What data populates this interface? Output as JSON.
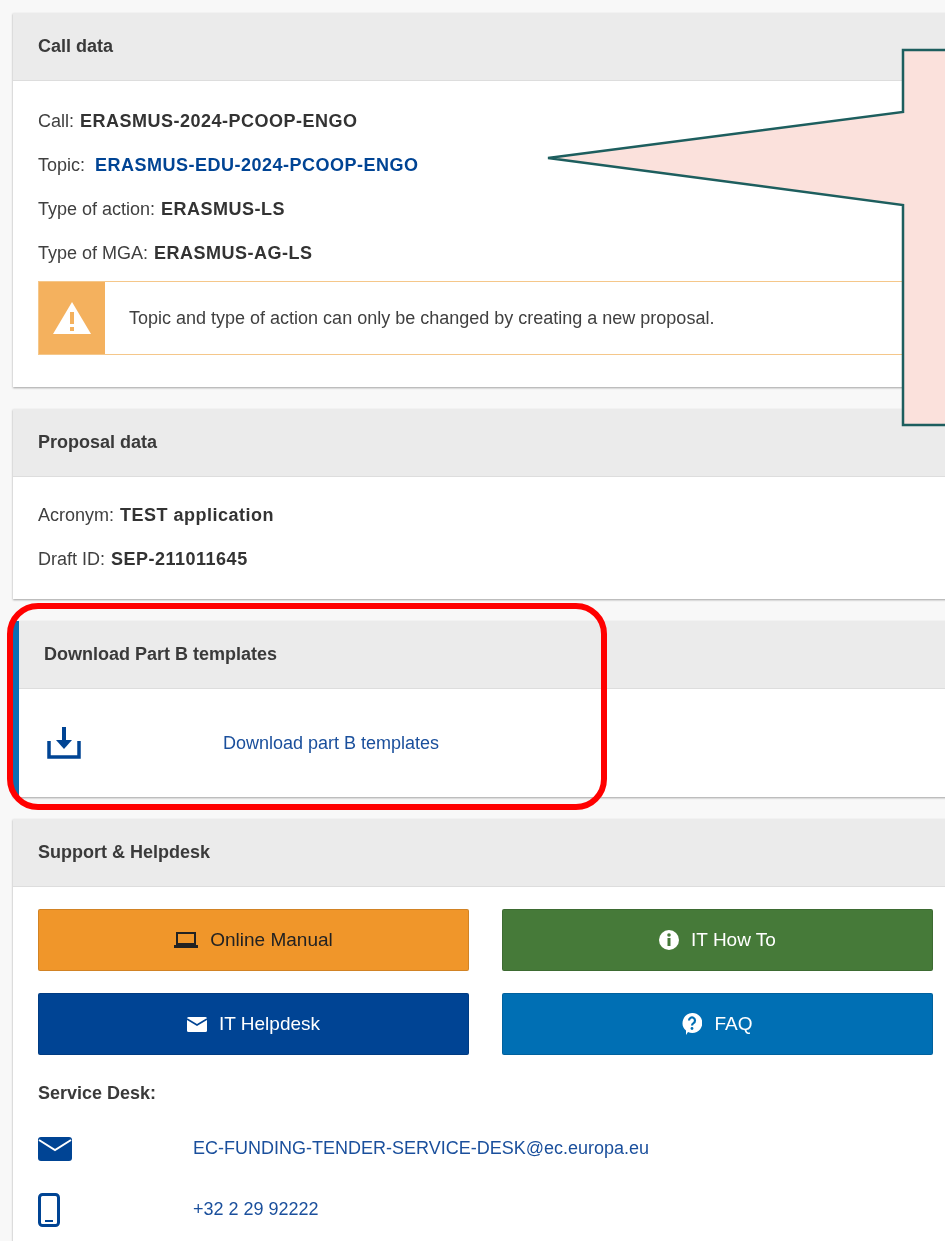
{
  "call_data": {
    "title": "Call data",
    "rows": [
      {
        "label": "Call:",
        "value": "ERASMUS-2024-PCOOP-ENGO",
        "kind": "text"
      },
      {
        "label": "Topic:",
        "value": "ERASMUS-EDU-2024-PCOOP-ENGO",
        "kind": "link"
      },
      {
        "label": "Type of action:",
        "value": "ERASMUS-LS",
        "kind": "text"
      },
      {
        "label": "Type of MGA:",
        "value": "ERASMUS-AG-LS",
        "kind": "text"
      }
    ],
    "warning": "Topic and type of action can only be changed by creating a new proposal."
  },
  "proposal_data": {
    "title": "Proposal data",
    "rows": [
      {
        "label": "Acronym:",
        "value": "TEST application"
      },
      {
        "label": "Draft ID:",
        "value": "SEP-211011645"
      }
    ]
  },
  "download": {
    "title": "Download Part B templates",
    "link": "Download part B templates"
  },
  "support": {
    "title": "Support & Helpdesk",
    "buttons": [
      {
        "label": "Online Manual",
        "kind": "laptop",
        "color": "#f0962a"
      },
      {
        "label": "IT How To",
        "kind": "info",
        "color": "#467a39"
      },
      {
        "label": "IT Helpdesk",
        "kind": "envelope",
        "color": "#004494"
      },
      {
        "label": "FAQ",
        "kind": "question",
        "color": "#006fb4"
      }
    ],
    "service_desk": {
      "title": "Service Desk:",
      "contacts": [
        {
          "kind": "email",
          "text": "EC-FUNDING-TENDER-SERVICE-DESK@ec.europa.eu"
        },
        {
          "kind": "phone",
          "text": "+32 2 29 92222"
        }
      ]
    }
  }
}
